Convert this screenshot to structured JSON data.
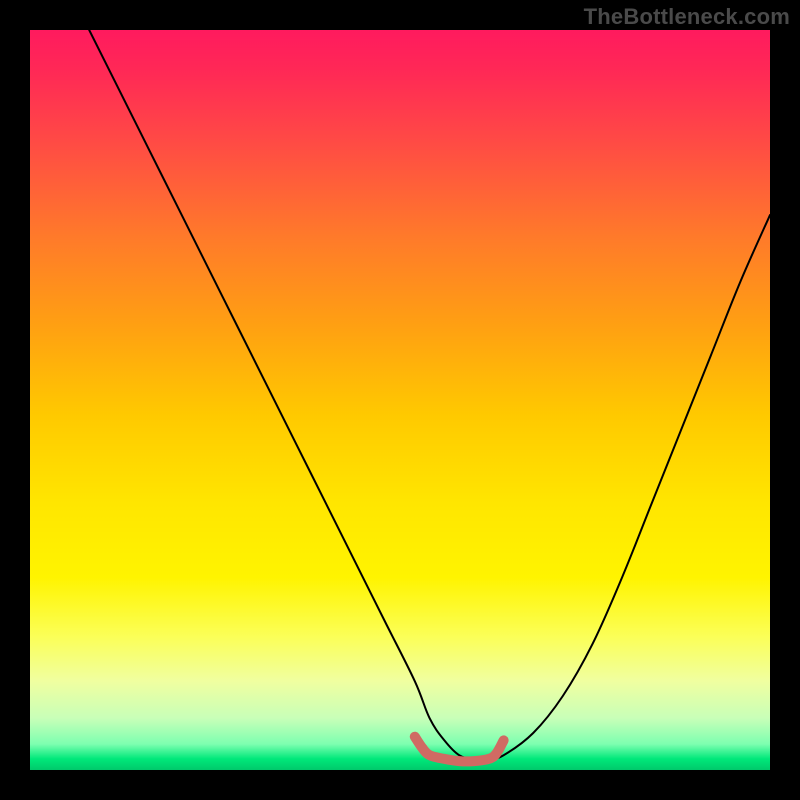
{
  "watermark": "TheBottleneck.com",
  "chart_data": {
    "type": "line",
    "title": "",
    "xlabel": "",
    "ylabel": "",
    "xlim": [
      0,
      100
    ],
    "ylim": [
      0,
      100
    ],
    "grid": false,
    "legend": false,
    "series": [
      {
        "name": "curve",
        "x": [
          8,
          12,
          16,
          20,
          24,
          28,
          32,
          36,
          40,
          44,
          48,
          52,
          54,
          56,
          58,
          60,
          62,
          64,
          68,
          72,
          76,
          80,
          84,
          88,
          92,
          96,
          100
        ],
        "values": [
          100,
          92,
          84,
          76,
          68,
          60,
          52,
          44,
          36,
          28,
          20,
          12,
          7,
          4,
          2,
          1.5,
          1.5,
          2,
          5,
          10,
          17,
          26,
          36,
          46,
          56,
          66,
          75
        ]
      },
      {
        "name": "optimal-range",
        "x": [
          52,
          53,
          54,
          56,
          58,
          60,
          62,
          63,
          64
        ],
        "values": [
          4.5,
          3,
          2,
          1.5,
          1.2,
          1.2,
          1.5,
          2.2,
          4
        ]
      }
    ],
    "gradient_stops": [
      {
        "pos": 0,
        "color": "#ff1a5e"
      },
      {
        "pos": 0.28,
        "color": "#ff7a2a"
      },
      {
        "pos": 0.52,
        "color": "#ffc900"
      },
      {
        "pos": 0.82,
        "color": "#fbff58"
      },
      {
        "pos": 0.97,
        "color": "#7dffb0"
      },
      {
        "pos": 1.0,
        "color": "#00c96b"
      }
    ]
  }
}
